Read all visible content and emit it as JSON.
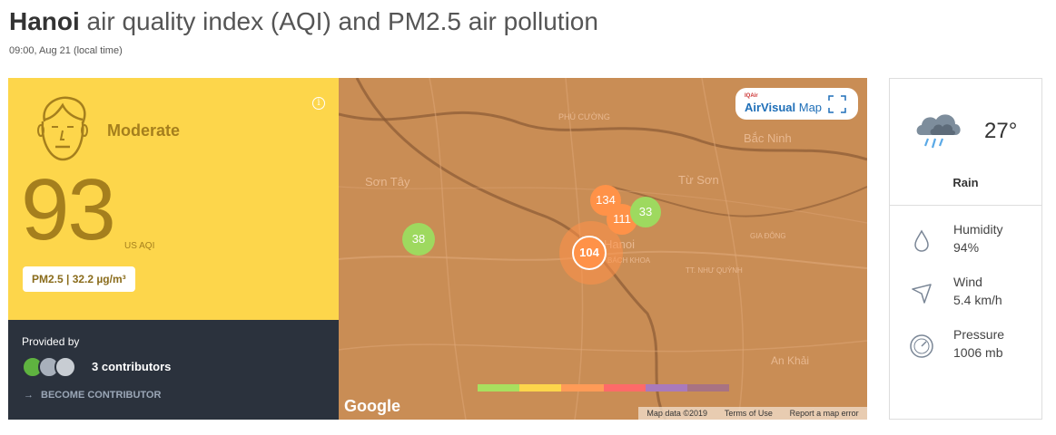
{
  "header": {
    "city": "Hanoi",
    "title_rest": " air quality index (AQI) and PM2.5 air pollution",
    "timestamp": "09:00, Aug 21 (local time)"
  },
  "aqi": {
    "level": "Moderate",
    "value": "93",
    "unit": "US AQI",
    "pm_label": "PM2.5 | 32.2 µg/m³",
    "info_symbol": "i",
    "panel_color": "#fdd64b",
    "text_color": "#a57f1d"
  },
  "contributors": {
    "provided_by": "Provided by",
    "count_label": "3 contributors",
    "become_label": "BECOME CONTRIBUTOR",
    "arrow": "→"
  },
  "map": {
    "brand_small": "IQAir",
    "brand": "AirVisual",
    "brand_suffix": "Map",
    "google": "Google",
    "places": [
      "PHÚ CƯỜNG",
      "Bắc Ninh",
      "Sơn Tây",
      "Từ Sơn",
      "GIA ĐÔNG",
      "TT. NHƯ QUỲNH",
      "An Khải",
      "Hanoi",
      "BÁCH KHOA"
    ],
    "stations": [
      {
        "value": "134",
        "color": "#ff9248"
      },
      {
        "value": "111",
        "color": "#ff9248"
      },
      {
        "value": "33",
        "color": "#9ed95f"
      },
      {
        "value": "38",
        "color": "#9ed95f"
      },
      {
        "value": "104",
        "color": "#ff9248"
      }
    ],
    "scale_colors": [
      "#a8e05f",
      "#fdd64b",
      "#ff9b57",
      "#fe6a69",
      "#a97abc",
      "#a87383"
    ],
    "attribution": [
      "Map data ©2019",
      "Terms of Use",
      "Report a map error"
    ]
  },
  "weather": {
    "temperature": "27°",
    "condition": "Rain",
    "humidity_label": "Humidity",
    "humidity_value": "94%",
    "wind_label": "Wind",
    "wind_value": "5.4 km/h",
    "pressure_label": "Pressure",
    "pressure_value": "1006 mb"
  }
}
